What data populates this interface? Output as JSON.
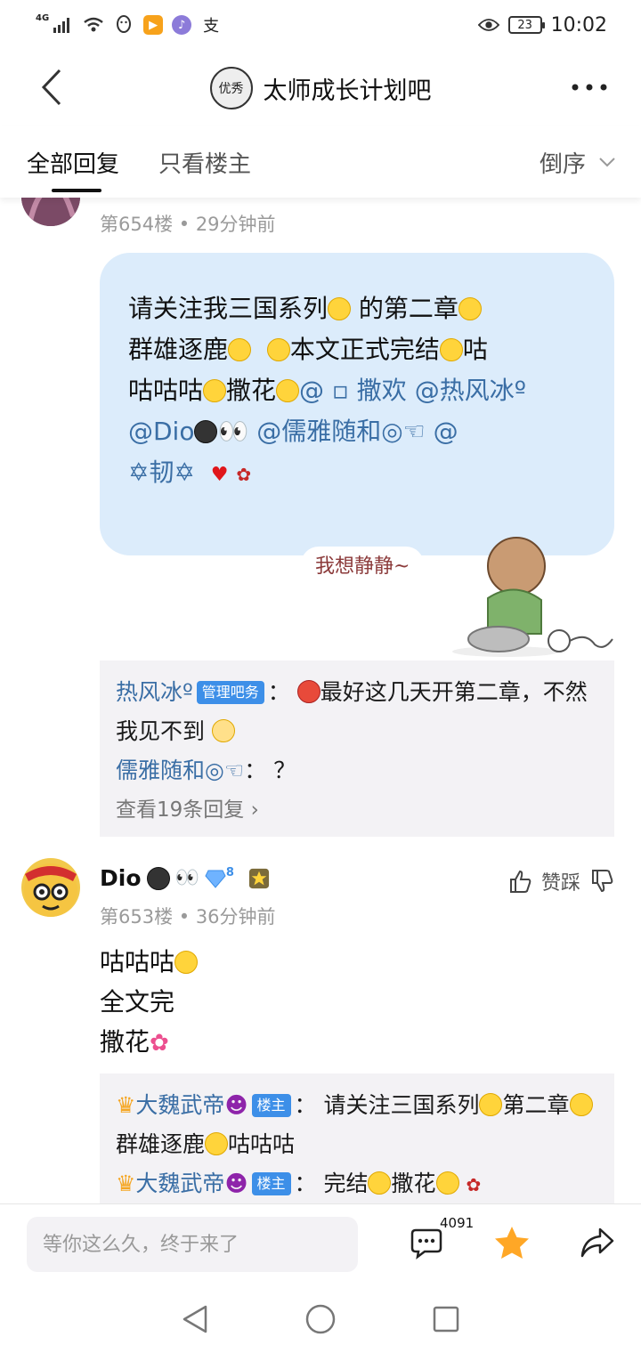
{
  "status_bar": {
    "network": "4G",
    "time": "10:02",
    "battery": "23",
    "app_icons": [
      "signal-icon",
      "wifi-icon",
      "qq-icon",
      "video-icon",
      "music-icon",
      "alipay-icon"
    ],
    "alipay_char": "支"
  },
  "header": {
    "title": "太师成长计划吧",
    "forum_logo_text": "优秀"
  },
  "tabs": [
    {
      "label": "全部回复",
      "active": true
    },
    {
      "label": "只看楼主",
      "active": false
    }
  ],
  "sort": {
    "label": "倒序"
  },
  "post654": {
    "meta": "第654楼 • 29分钟前",
    "bubble_lines": [
      "请关注我三国系列",
      " 的第二章",
      "群雄逐鹿",
      "本文正式完结",
      "咕",
      "咕咕咕",
      "撒花",
      "@ ▫ 撒欢  @热风冰º  @Dio",
      "👀  @儒雅随和◎☜  @",
      "✡韧✡"
    ],
    "sticker_text": "我想静静~",
    "replies": [
      {
        "name": "热风冰º",
        "tag": "管理吧务",
        "text": "最好这几天开第二章，不然我见不到"
      },
      {
        "name": "儒雅随和◎☜",
        "text": "？"
      }
    ],
    "view_more": "查看19条回复"
  },
  "post653": {
    "username": "Dio",
    "eyes": "👀",
    "level": "8",
    "vote_label": "赞踩",
    "meta": "第653楼 • 36分钟前",
    "body_lines": [
      "咕咕咕",
      "全文完",
      "撒花"
    ],
    "replies": [
      {
        "name": "大魏武帝",
        "tag": "楼主",
        "text": "请关注三国系列",
        "text2": "第二章",
        "text3": "群雄逐鹿",
        "text4": "咕咕咕"
      },
      {
        "name": "大魏武帝",
        "tag": "楼主",
        "text": "完结",
        "text2": "撒花"
      }
    ]
  },
  "bottom": {
    "placeholder": "等你这么久，终于来了",
    "comment_count": "4091"
  },
  "colors": {
    "accent_blue": "#3d8fe8",
    "link_blue": "#3a6ea5",
    "bubble_bg": "#dcecfb",
    "reply_bg": "#f3f2f5",
    "star": "#ffa726"
  }
}
